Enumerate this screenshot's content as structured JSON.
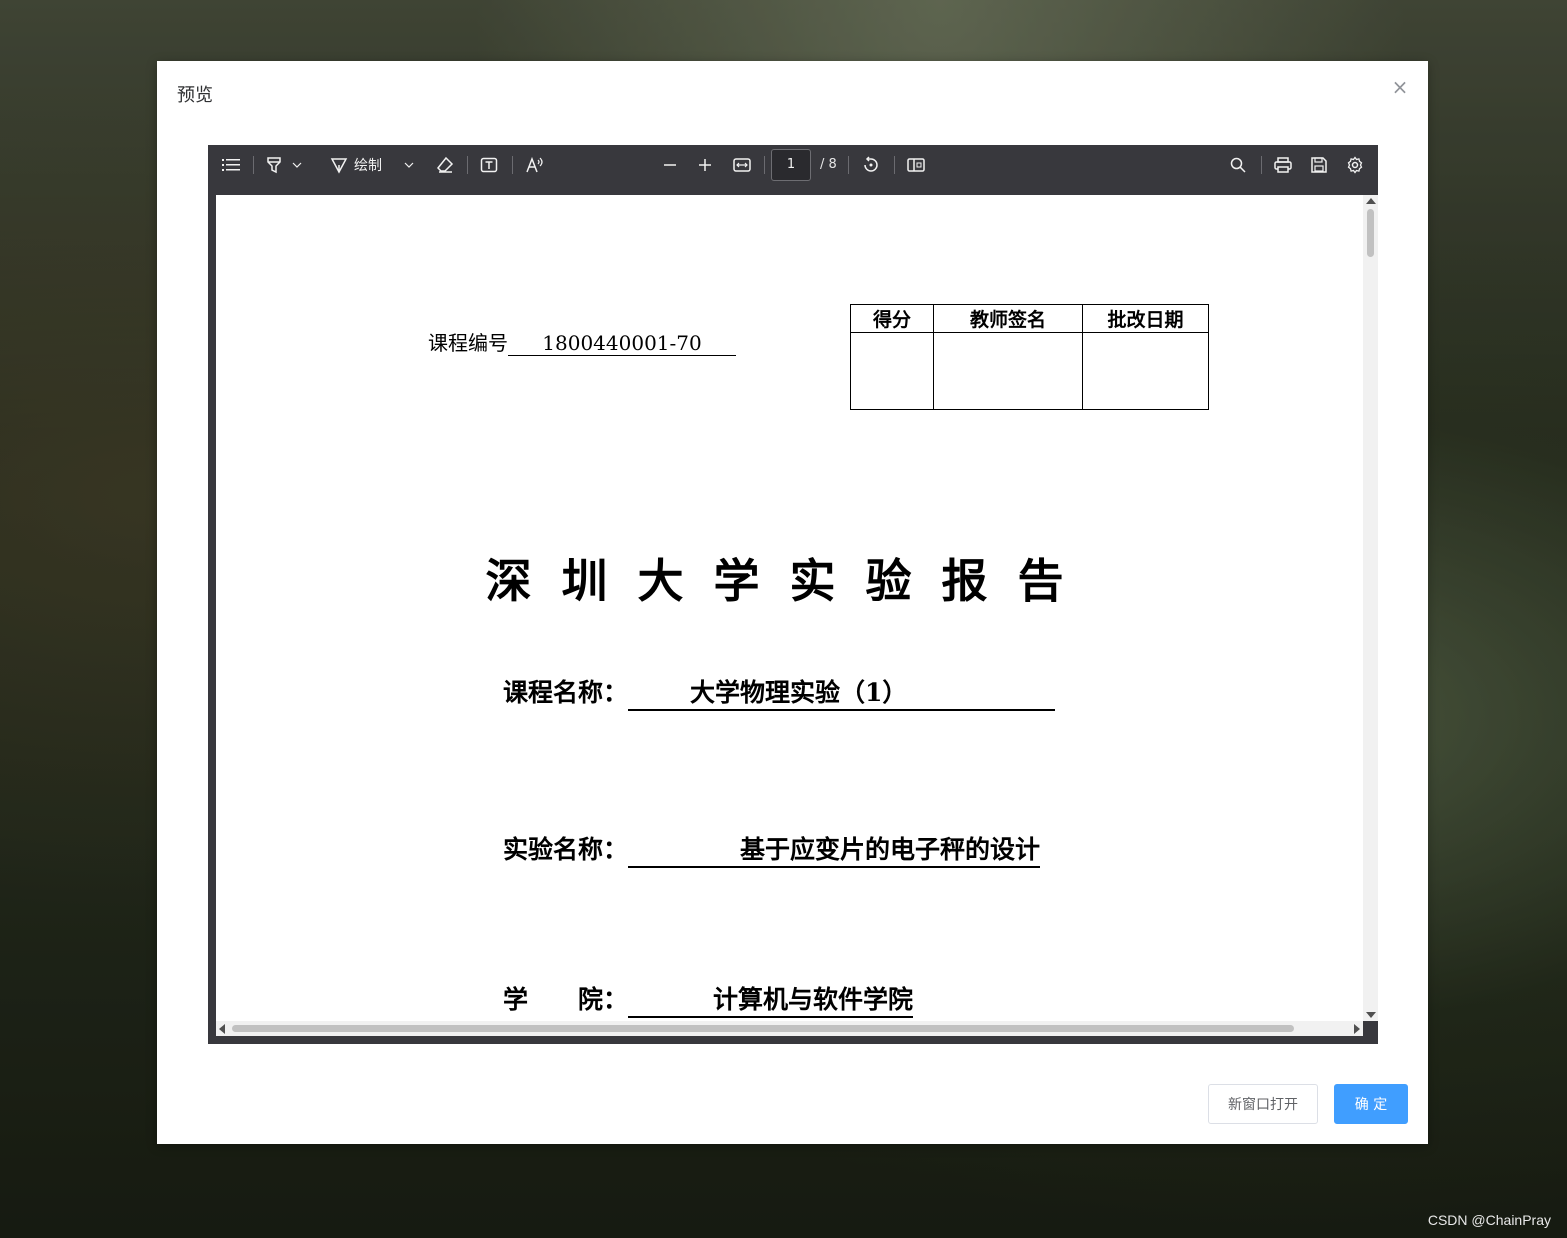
{
  "dialog": {
    "title": "预览",
    "close_glyph": "×"
  },
  "toolbar": {
    "draw_label": "绘制",
    "page_current": "1",
    "page_total": "/ 8",
    "icons": [
      "sidebar-toggle-icon",
      "highlight-icon",
      "chevron-down-icon",
      "draw-icon",
      "chevron-down-icon",
      "eraser-icon",
      "text-box-icon",
      "read-aloud-icon",
      "zoom-out-icon",
      "zoom-in-icon",
      "fit-width-icon",
      "rotate-icon",
      "page-view-icon",
      "search-icon",
      "print-icon",
      "save-icon",
      "settings-icon"
    ]
  },
  "document": {
    "course_code_label": "课程编号",
    "course_code_value": "1800440001-70",
    "score_table": {
      "headers": [
        "得分",
        "教师签名",
        "批改日期"
      ]
    },
    "title": "深圳大学实验报告",
    "fields": [
      {
        "label": "课程名称：",
        "value": "大学物理实验（1）"
      },
      {
        "label": "实验名称：",
        "value": "基于应变片的电子秤的设计"
      },
      {
        "label": "学　　院：",
        "value": "计算机与软件学院"
      }
    ]
  },
  "footer": {
    "open_new_window": "新窗口打开",
    "confirm": "确 定"
  },
  "watermark": "CSDN @ChainPray",
  "colors": {
    "primary": "#409eff",
    "toolbar_bg": "#38383d"
  }
}
